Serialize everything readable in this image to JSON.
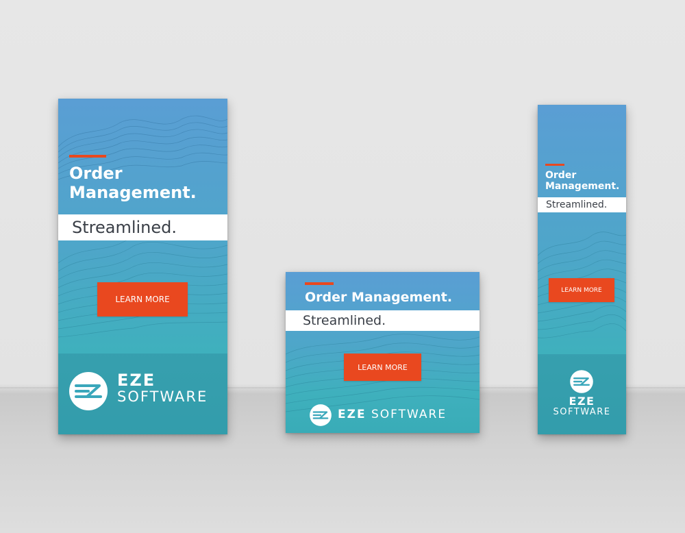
{
  "banners": {
    "skyscraper": {
      "headline_line1": "Order",
      "headline_line2": "Management.",
      "subhead": "Streamlined.",
      "cta_label": "LEARN MORE",
      "brand_line1": "EZE",
      "brand_line2": "SOFTWARE"
    },
    "rectangle": {
      "headline": "Order Management.",
      "subhead": "Streamlined.",
      "cta_label": "LEARN MORE",
      "brand_line1": "EZE",
      "brand_line2": "SOFTWARE"
    },
    "vertical": {
      "headline_line1": "Order",
      "headline_line2": "Management.",
      "subhead": "Streamlined.",
      "cta_label": "LEARN MORE",
      "brand_line1": "EZE",
      "brand_line2": "SOFTWARE"
    }
  },
  "colors": {
    "accent": "#e9481f",
    "banner_top": "#5a9ed4",
    "banner_bottom": "#39acb7",
    "text_light": "#ffffff",
    "text_dark": "#3a3f47"
  },
  "icons": {
    "logo": "eze-logo-icon"
  }
}
